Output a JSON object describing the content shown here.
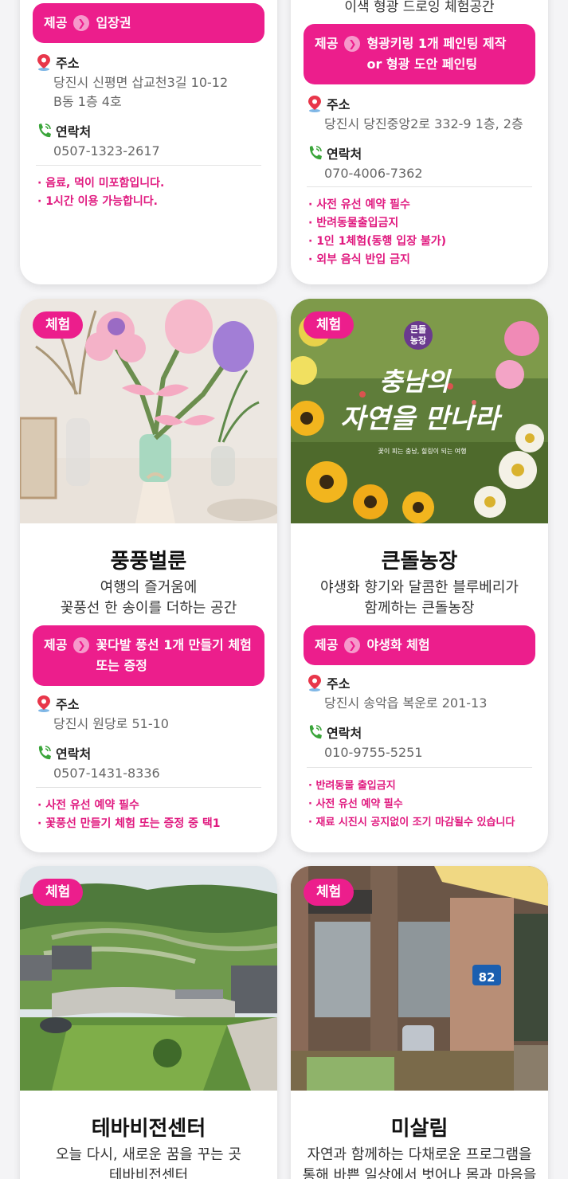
{
  "labels": {
    "provide": "제공",
    "address": "주소",
    "contact": "연락처",
    "experience_tag": "체험"
  },
  "cards": [
    {
      "provide": "입장권",
      "address": "당진시 신평면 삽교천3길 10-12 B동 1층 4호",
      "contact": "0507-1323-2617",
      "notes": [
        "· 음료, 먹이 미포함입니다.",
        "· 1시간 이용 가능합니다."
      ]
    },
    {
      "desc_partial": "이색 형광 드로잉 체험공간",
      "provide": "형광키링 1개 페인팅 제작 or 형광 도안 페인팅",
      "address": "당진시 당진중앙2로 332-9 1층, 2층",
      "contact": "070-4006-7362",
      "notes": [
        "· 사전 유선 예약 필수",
        "· 반려동물출입금지",
        "· 1인 1체험(동행 입장 불가)",
        "· 외부 음식 반입 금지"
      ]
    },
    {
      "tag": "체험",
      "title": "풍풍벌룬",
      "desc": [
        "여행의 즐거움에",
        "꽃풍선 한 송이를 더하는 공간"
      ],
      "provide": "꽃다발 풍선 1개 만들기 체험 또는 증정",
      "address": "당진시 원당로 51-10",
      "contact": "0507-1431-8336",
      "notes": [
        "· 사전 유선 예약 필수",
        "· 꽃풍선 만들기 체험 또는 증정 중 택1"
      ]
    },
    {
      "tag": "체험",
      "title": "큰돌농장",
      "desc": [
        "야생화 향기와 달콤한 블루베리가",
        "함께하는 큰돌농장"
      ],
      "photo_badge": [
        "큰돌",
        "농장"
      ],
      "photo_title": [
        "충남의",
        "자연을 만나라"
      ],
      "photo_caption": "꽃이 피는 충남, 힐링이 되는 여행",
      "provide": "야생화 체험",
      "address": "당진시 송악읍 복운로 201-13",
      "contact": "010-9755-5251",
      "notes": [
        "· 반려동물 출입금지",
        "· 사전 유선 예약 필수",
        "· 재료 시진시 공지없이 조기 마감될수 있습니다"
      ]
    },
    {
      "tag": "체험",
      "title": "테바비전센터",
      "desc": [
        "오늘 다시, 새로운 꿈을 꾸는 곳",
        "테바비전센터"
      ]
    },
    {
      "tag": "체험",
      "title": "미살림",
      "desc": [
        "자연과 함께하는 다채로운 프로그램을",
        "통해 바쁜 일상에서 벗어나 몸과 마음을"
      ],
      "photo_sign": "82"
    }
  ],
  "colors": {
    "accent": "#ec1e8c",
    "note": "#e0197f",
    "phone_icon": "#3aa53a",
    "pin_icon": "#e8364a"
  },
  "icons": [
    "pin-icon",
    "phone-icon",
    "chevron-right-icon"
  ]
}
